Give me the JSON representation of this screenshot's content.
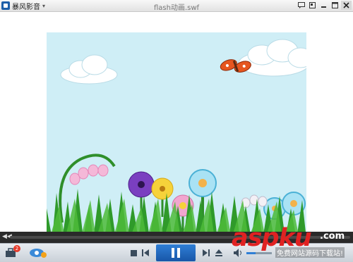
{
  "app": {
    "name": "暴风影音",
    "window_title": "flash动画.swf"
  },
  "titlebar": {
    "controls": [
      {
        "name": "chat-icon",
        "glyph": "▭"
      },
      {
        "name": "pin-icon",
        "glyph": "▣"
      },
      {
        "name": "minimize-icon",
        "glyph": "▬"
      },
      {
        "name": "maximize-icon",
        "glyph": "□"
      },
      {
        "name": "close-icon",
        "glyph": "✕"
      }
    ]
  },
  "player": {
    "progress_fraction": 0.0,
    "volume_fraction": 0.35,
    "notification_count": "2"
  },
  "colors": {
    "sky": "#cfeef6",
    "grass": "#2f9a2a",
    "accent": "#2f7fd6"
  },
  "watermark": {
    "main": "aspku",
    "suffix": ".com",
    "subtitle": "免费网站源码下载站!"
  }
}
